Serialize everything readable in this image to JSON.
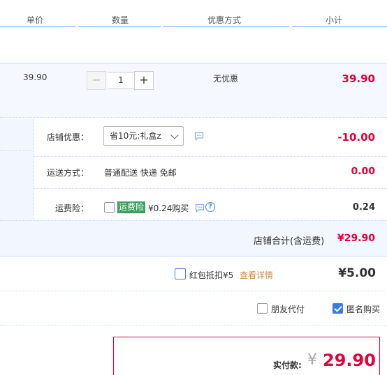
{
  "header": {
    "col_price": "单价",
    "col_qty": "数量",
    "col_discount": "优惠方式",
    "col_subtotal": "小计"
  },
  "item": {
    "unit_price": "39.90",
    "minus": "−",
    "quantity": "1",
    "plus": "+",
    "discount": "无优惠",
    "subtotal": "39.90"
  },
  "shop": {
    "coupon_label": "店铺优惠：",
    "coupon_selected": "省10元:礼盒z",
    "coupon_value": "-10.00",
    "shipping_label": "运送方式：",
    "shipping_method": "普通配送 快递 免邮",
    "shipping_value": "0.00",
    "insurance_label": "运费险：",
    "insurance_tag": "运费险",
    "insurance_price": "¥0.24购买",
    "insurance_value": "0.24",
    "total_label": "店铺合计(含运费)",
    "total_value": "¥29.90"
  },
  "redpacket": {
    "label": "红包抵扣¥5",
    "details_link": "查看详情",
    "value": "¥5.00"
  },
  "options": {
    "friend_pay": "朋友代付",
    "anonymous": "匿名购买",
    "anonymous_checked": true
  },
  "payment": {
    "label": "实付款:",
    "currency": "¥",
    "amount": "29.90"
  },
  "colors": {
    "price_red": "#e4003a",
    "accent_blue": "#3a7ae8",
    "tag_green": "#3ca05f"
  }
}
